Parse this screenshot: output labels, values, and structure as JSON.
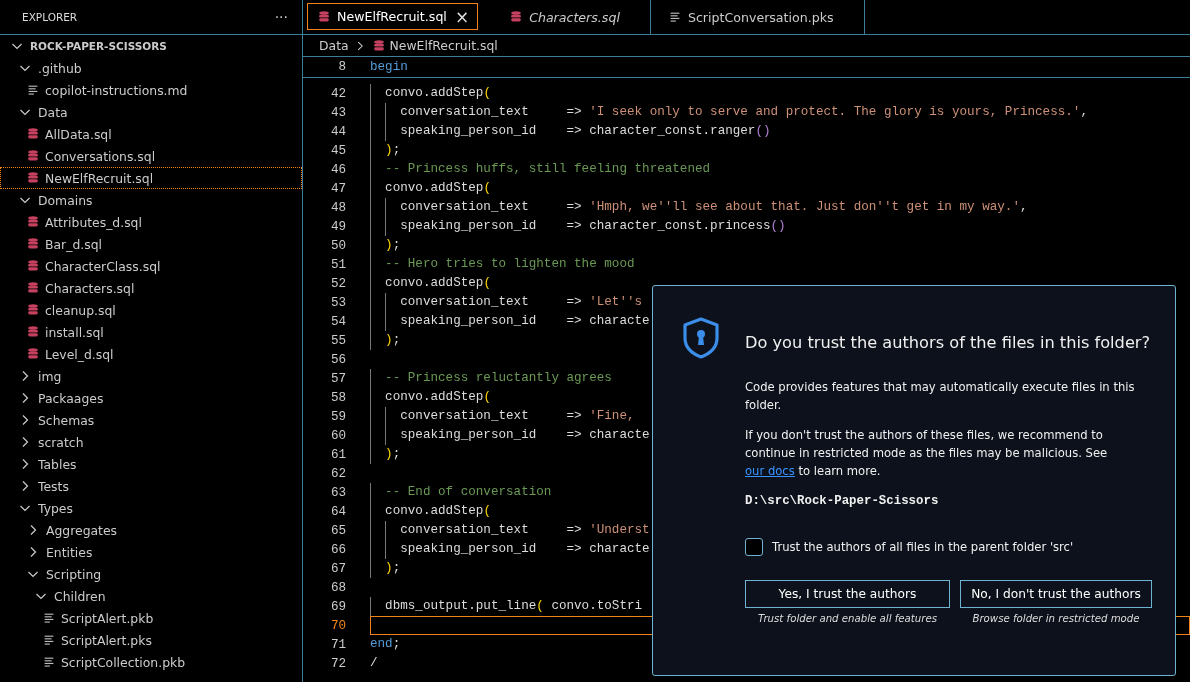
{
  "sidebar": {
    "title": "EXPLORER",
    "more": "···",
    "tree": [
      {
        "label": "ROCK-PAPER-SCISSORS",
        "kind": "root",
        "expanded": true,
        "selected": false,
        "children": [
          {
            "label": ".github",
            "kind": "folder",
            "expanded": true,
            "selected": false,
            "children": [
              {
                "label": "copilot-instructions.md",
                "kind": "text",
                "selected": false
              }
            ]
          },
          {
            "label": "Data",
            "kind": "folder",
            "expanded": true,
            "selected": false,
            "children": [
              {
                "label": "AllData.sql",
                "kind": "sql",
                "selected": false
              },
              {
                "label": "Conversations.sql",
                "kind": "sql",
                "selected": false
              },
              {
                "label": "NewElfRecruit.sql",
                "kind": "sql",
                "selected": true
              }
            ]
          },
          {
            "label": "Domains",
            "kind": "folder",
            "expanded": true,
            "selected": false,
            "children": [
              {
                "label": "Attributes_d.sql",
                "kind": "sql",
                "selected": false
              },
              {
                "label": "Bar_d.sql",
                "kind": "sql",
                "selected": false
              },
              {
                "label": "CharacterClass.sql",
                "kind": "sql",
                "selected": false
              },
              {
                "label": "Characters.sql",
                "kind": "sql",
                "selected": false
              },
              {
                "label": "cleanup.sql",
                "kind": "sql",
                "selected": false
              },
              {
                "label": "install.sql",
                "kind": "sql",
                "selected": false
              },
              {
                "label": "Level_d.sql",
                "kind": "sql",
                "selected": false
              }
            ]
          },
          {
            "label": "img",
            "kind": "folder",
            "expanded": false,
            "selected": false
          },
          {
            "label": "Packaages",
            "kind": "folder",
            "expanded": false,
            "selected": false
          },
          {
            "label": "Schemas",
            "kind": "folder",
            "expanded": false,
            "selected": false
          },
          {
            "label": "scratch",
            "kind": "folder",
            "expanded": false,
            "selected": false
          },
          {
            "label": "Tables",
            "kind": "folder",
            "expanded": false,
            "selected": false
          },
          {
            "label": "Tests",
            "kind": "folder",
            "expanded": false,
            "selected": false
          },
          {
            "label": "Types",
            "kind": "folder",
            "expanded": true,
            "selected": false,
            "children": [
              {
                "label": "Aggregates",
                "kind": "folder",
                "expanded": false,
                "selected": false
              },
              {
                "label": "Entities",
                "kind": "folder",
                "expanded": false,
                "selected": false
              },
              {
                "label": "Scripting",
                "kind": "folder",
                "expanded": true,
                "selected": false,
                "children": [
                  {
                    "label": "Children",
                    "kind": "folder",
                    "expanded": true,
                    "selected": false,
                    "children": [
                      {
                        "label": "ScriptAlert.pkb",
                        "kind": "text",
                        "selected": false
                      },
                      {
                        "label": "ScriptAlert.pks",
                        "kind": "text",
                        "selected": false
                      },
                      {
                        "label": "ScriptCollection.pkb",
                        "kind": "text",
                        "selected": false
                      }
                    ]
                  }
                ]
              }
            ]
          }
        ]
      }
    ]
  },
  "tabs": [
    {
      "label": "NewElfRecruit.sql",
      "kind": "sql",
      "selected": true,
      "preview": false,
      "close": "×"
    },
    {
      "label": "Characters.sql",
      "kind": "sql",
      "selected": false,
      "preview": true
    },
    {
      "label": "ScriptConversation.pks",
      "kind": "text",
      "selected": false,
      "preview": false
    }
  ],
  "breadcrumb": [
    {
      "label": "Data",
      "kind": "folder"
    },
    {
      "label": "NewElfRecruit.sql",
      "kind": "sql"
    }
  ],
  "editor": {
    "sticky": {
      "number": "8",
      "tokens": [
        {
          "kind": "keyword",
          "s": "begin"
        }
      ]
    },
    "lines": [
      {
        "number": "42",
        "current": false,
        "tokens": [
          {
            "kind": "plain",
            "s": "  convo.addStep"
          },
          {
            "kind": "bracket",
            "s": "("
          }
        ]
      },
      {
        "number": "43",
        "current": false,
        "tokens": [
          {
            "kind": "plain",
            "s": "    conversation_text     => "
          },
          {
            "kind": "string",
            "s": "'I seek only to serve and protect. The glory is yours, Princess.'"
          },
          {
            "kind": "plain",
            "s": ","
          }
        ]
      },
      {
        "number": "44",
        "current": false,
        "tokens": [
          {
            "kind": "plain",
            "s": "    speaking_person_id    => character_const.ranger"
          },
          {
            "kind": "bracket2",
            "s": "()"
          }
        ]
      },
      {
        "number": "45",
        "current": false,
        "tokens": [
          {
            "kind": "bracket",
            "s": "  )"
          },
          {
            "kind": "plain",
            "s": ";"
          }
        ]
      },
      {
        "number": "46",
        "current": false,
        "tokens": [
          {
            "kind": "comment",
            "s": "  -- Princess huffs, still feeling threatened"
          }
        ]
      },
      {
        "number": "47",
        "current": false,
        "tokens": [
          {
            "kind": "plain",
            "s": "  convo.addStep"
          },
          {
            "kind": "bracket",
            "s": "("
          }
        ]
      },
      {
        "number": "48",
        "current": false,
        "tokens": [
          {
            "kind": "plain",
            "s": "    conversation_text     => "
          },
          {
            "kind": "string",
            "s": "'Hmph, we''ll see about that. Just don''t get in my way.'"
          },
          {
            "kind": "plain",
            "s": ","
          }
        ]
      },
      {
        "number": "49",
        "current": false,
        "tokens": [
          {
            "kind": "plain",
            "s": "    speaking_person_id    => character_const.princess"
          },
          {
            "kind": "bracket2",
            "s": "()"
          }
        ]
      },
      {
        "number": "50",
        "current": false,
        "tokens": [
          {
            "kind": "bracket",
            "s": "  )"
          },
          {
            "kind": "plain",
            "s": ";"
          }
        ]
      },
      {
        "number": "51",
        "current": false,
        "tokens": [
          {
            "kind": "comment",
            "s": "  -- Hero tries to lighten the mood"
          }
        ]
      },
      {
        "number": "52",
        "current": false,
        "tokens": [
          {
            "kind": "plain",
            "s": "  convo.addStep"
          },
          {
            "kind": "bracket",
            "s": "("
          }
        ]
      },
      {
        "number": "53",
        "current": false,
        "tokens": [
          {
            "kind": "plain",
            "s": "    conversation_text     => "
          },
          {
            "kind": "string",
            "s": "'Let''s"
          }
        ]
      },
      {
        "number": "54",
        "current": false,
        "tokens": [
          {
            "kind": "plain",
            "s": "    speaking_person_id    => characte"
          }
        ]
      },
      {
        "number": "55",
        "current": false,
        "tokens": [
          {
            "kind": "bracket",
            "s": "  )"
          },
          {
            "kind": "plain",
            "s": ";"
          }
        ]
      },
      {
        "number": "56",
        "current": false
      },
      {
        "number": "57",
        "current": false,
        "tokens": [
          {
            "kind": "comment",
            "s": "  -- Princess reluctantly agrees"
          }
        ]
      },
      {
        "number": "58",
        "current": false,
        "tokens": [
          {
            "kind": "plain",
            "s": "  convo.addStep"
          },
          {
            "kind": "bracket",
            "s": "("
          }
        ]
      },
      {
        "number": "59",
        "current": false,
        "tokens": [
          {
            "kind": "plain",
            "s": "    conversation_text     => "
          },
          {
            "kind": "string",
            "s": "'Fine,"
          }
        ]
      },
      {
        "number": "60",
        "current": false,
        "tokens": [
          {
            "kind": "plain",
            "s": "    speaking_person_id    => characte"
          }
        ]
      },
      {
        "number": "61",
        "current": false,
        "tokens": [
          {
            "kind": "bracket",
            "s": "  )"
          },
          {
            "kind": "plain",
            "s": ";"
          }
        ]
      },
      {
        "number": "62",
        "current": false
      },
      {
        "number": "63",
        "current": false,
        "tokens": [
          {
            "kind": "comment",
            "s": "  -- End of conversation"
          }
        ]
      },
      {
        "number": "64",
        "current": false,
        "tokens": [
          {
            "kind": "plain",
            "s": "  convo.addStep"
          },
          {
            "kind": "bracket",
            "s": "("
          }
        ]
      },
      {
        "number": "65",
        "current": false,
        "tokens": [
          {
            "kind": "plain",
            "s": "    conversation_text     => "
          },
          {
            "kind": "string",
            "s": "'Underst"
          }
        ]
      },
      {
        "number": "66",
        "current": false,
        "tokens": [
          {
            "kind": "plain",
            "s": "    speaking_person_id    => characte"
          }
        ]
      },
      {
        "number": "67",
        "current": false,
        "tokens": [
          {
            "kind": "bracket",
            "s": "  )"
          },
          {
            "kind": "plain",
            "s": ";"
          }
        ]
      },
      {
        "number": "68",
        "current": false
      },
      {
        "number": "69",
        "current": false,
        "tokens": [
          {
            "kind": "plain",
            "s": "  dbms_output.put_line"
          },
          {
            "kind": "bracket",
            "s": "("
          },
          {
            "kind": "plain",
            "s": " convo.toStri"
          }
        ]
      },
      {
        "number": "70",
        "current": true
      },
      {
        "number": "71",
        "current": false,
        "tokens": [
          {
            "kind": "keyword",
            "s": "end"
          },
          {
            "kind": "plain",
            "s": ";"
          }
        ]
      },
      {
        "number": "72",
        "current": false,
        "tokens": [
          {
            "kind": "plain",
            "s": "/"
          }
        ]
      }
    ]
  },
  "dialog": {
    "title": "Do you trust the authors of the files in this folder?",
    "message": "Code provides features that may automatically execute files in this folder.",
    "detail_before": "If you don't trust the authors of these files, we recommend to continue in restricted mode as the files may be malicious. See",
    "link": "our docs",
    "detail_after": "to learn more.",
    "path": "D:\\src\\Rock-Paper-Scissors",
    "checkbox": {
      "label": "Trust the authors of all files in the parent folder 'src'",
      "checked": false
    },
    "buttons": [
      {
        "label": "Yes, I trust the authors",
        "caption": "Trust folder and enable all features"
      },
      {
        "label": "No, I don't trust the authors",
        "caption": "Browse folder in restricted mode"
      }
    ]
  }
}
